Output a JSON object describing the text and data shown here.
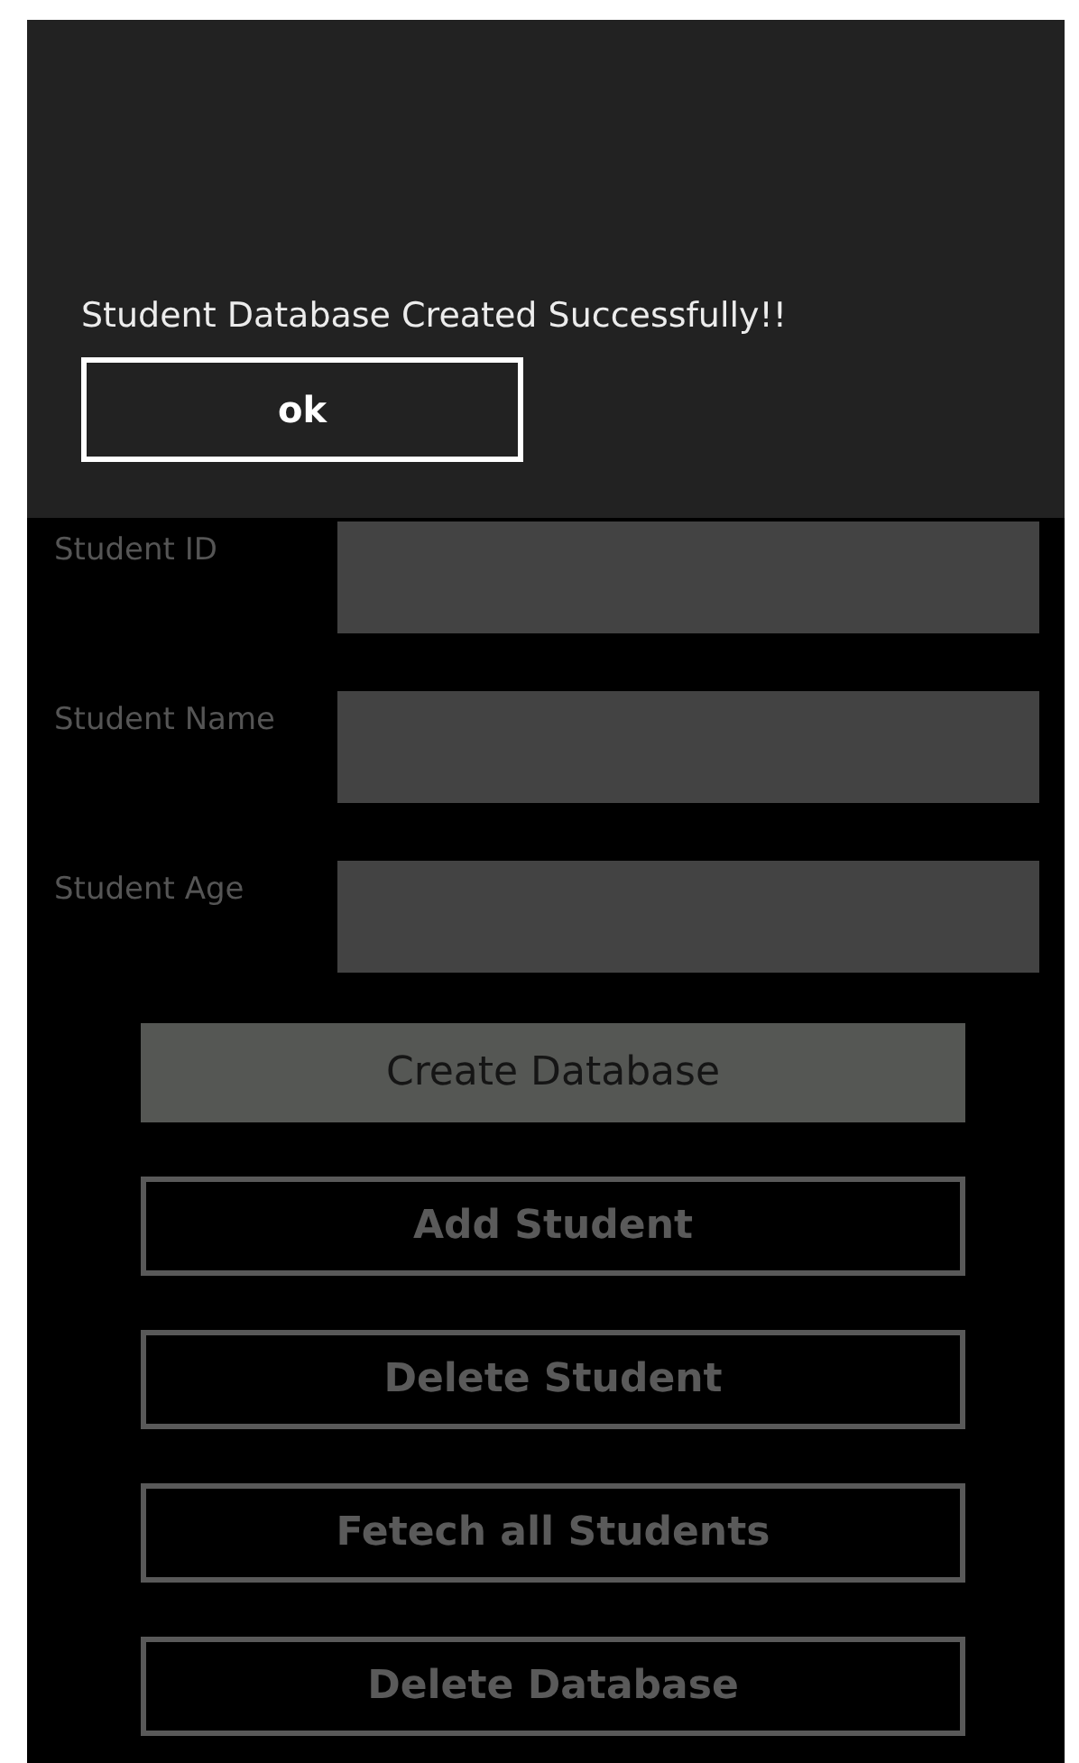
{
  "dialog": {
    "message": "Student Database Created Successfully!!",
    "button": "ok"
  },
  "fields": [
    {
      "label": "Student ID"
    },
    {
      "label": "Student Name"
    },
    {
      "label": "Student Age"
    }
  ],
  "buttons": [
    {
      "label": "Create Database",
      "pressed": true
    },
    {
      "label": "Add Student",
      "pressed": false
    },
    {
      "label": "Delete Student",
      "pressed": false
    },
    {
      "label": "Fetech all Students",
      "pressed": false
    },
    {
      "label": "Delete Database",
      "pressed": false
    }
  ]
}
